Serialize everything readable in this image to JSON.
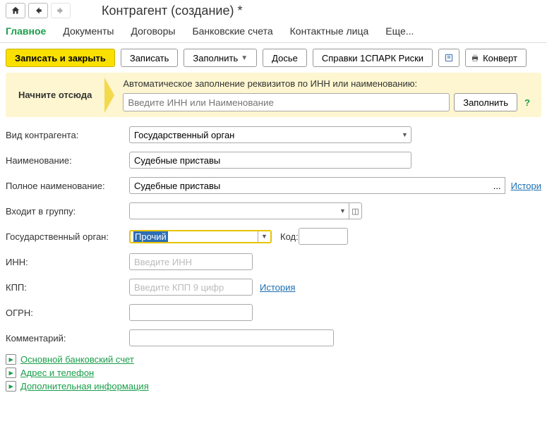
{
  "title": "Контрагент (создание) *",
  "tabs": [
    "Главное",
    "Документы",
    "Договоры",
    "Банковские счета",
    "Контактные лица",
    "Еще..."
  ],
  "toolbar": {
    "save_close": "Записать и закрыть",
    "save": "Записать",
    "fill": "Заполнить",
    "dossier": "Досье",
    "spark": "Справки 1СПАРК Риски",
    "convert": "Конверт"
  },
  "infobox": {
    "start": "Начните отсюда",
    "text": "Автоматическое заполнение реквизитов по ИНН или наименованию:",
    "placeholder": "Введите ИНН или Наименование",
    "fill_btn": "Заполнить"
  },
  "labels": {
    "type": "Вид контрагента:",
    "name": "Наименование:",
    "full_name": "Полное наименование:",
    "group": "Входит в группу:",
    "gov": "Государственный орган:",
    "code": "Код:",
    "inn": "ИНН:",
    "kpp": "КПП:",
    "ogrn": "ОГРН:",
    "comment": "Комментарий:"
  },
  "values": {
    "type": "Государственный орган",
    "name": "Судебные приставы",
    "full_name": "Судебные приставы",
    "gov": "Прочий"
  },
  "placeholders": {
    "inn": "Введите ИНН",
    "kpp": "Введите КПП 9 цифр"
  },
  "links": {
    "history": "История",
    "history2": "Истори"
  },
  "expands": {
    "bank": "Основной банковский счет",
    "address": "Адрес и телефон",
    "extra": "Дополнительная информация"
  }
}
